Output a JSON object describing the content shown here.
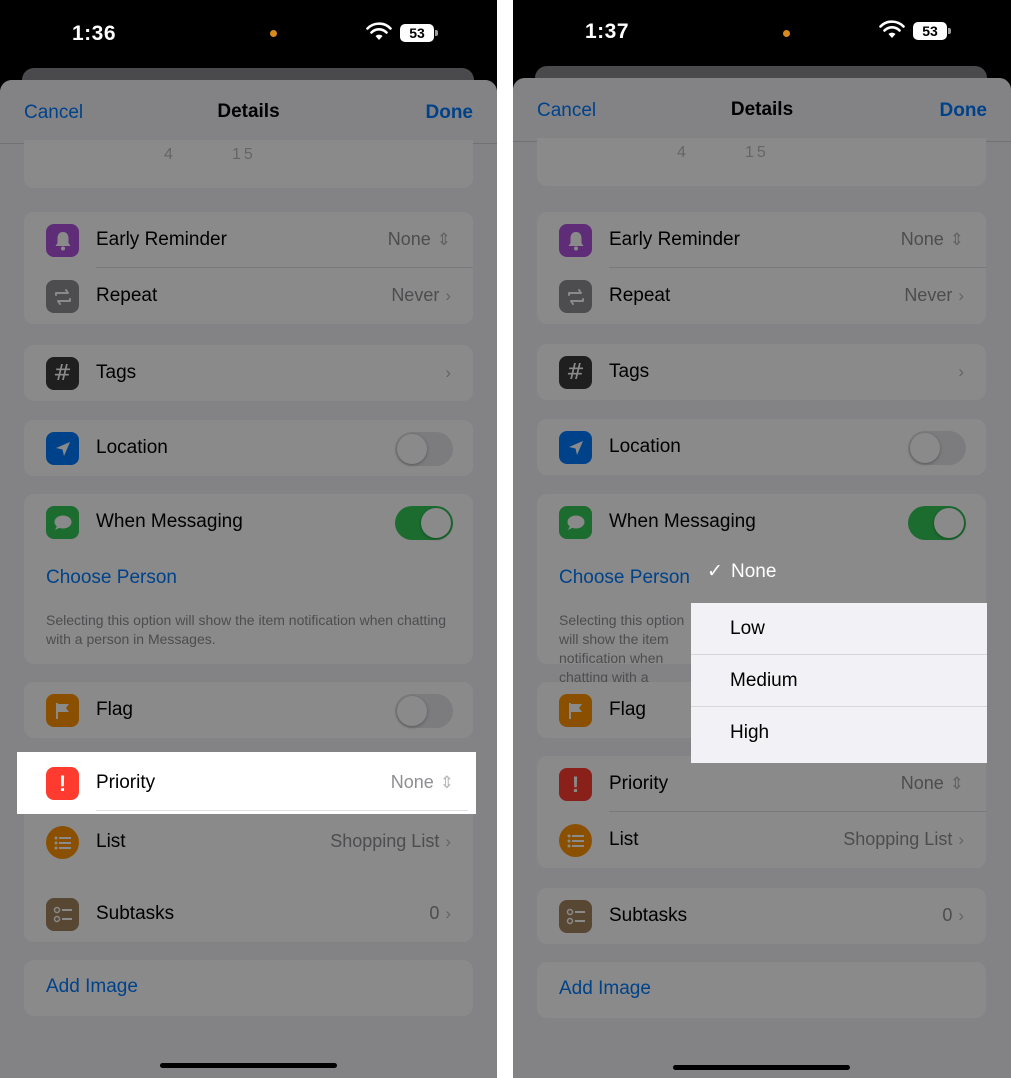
{
  "status_left": {
    "time": "1:36",
    "battery": "53"
  },
  "status_right": {
    "time": "1:37",
    "battery": "53"
  },
  "nav": {
    "cancel": "Cancel",
    "title": "Details",
    "done": "Done"
  },
  "time_picker": {
    "hour": "4",
    "minute": "15"
  },
  "rows": {
    "early_reminder": {
      "label": "Early Reminder",
      "value": "None"
    },
    "repeat": {
      "label": "Repeat",
      "value": "Never"
    },
    "tags": {
      "label": "Tags"
    },
    "location": {
      "label": "Location",
      "on": false
    },
    "when_messaging": {
      "label": "When Messaging",
      "on": true
    },
    "choose_person": "Choose Person",
    "messaging_footnote": "Selecting this option will show the item notification when chatting with a person in Messages.",
    "flag": {
      "label": "Flag",
      "on": false
    },
    "priority": {
      "label": "Priority",
      "value": "None"
    },
    "list": {
      "label": "List",
      "value": "Shopping List"
    },
    "subtasks": {
      "label": "Subtasks",
      "value": "0"
    },
    "add_image": "Add Image"
  },
  "priority_menu": {
    "selected": "None",
    "check": "✓",
    "options": [
      "Low",
      "Medium",
      "High"
    ]
  },
  "icon_colors": {
    "early_reminder": "#af52de",
    "repeat": "#8e8e93",
    "tags": "#3a3a3c",
    "location": "#007aff",
    "when_messaging": "#34c759",
    "flag": "#ff9500",
    "priority": "#ff3b30",
    "list": "#ff9500",
    "subtasks": "#a2845e"
  }
}
